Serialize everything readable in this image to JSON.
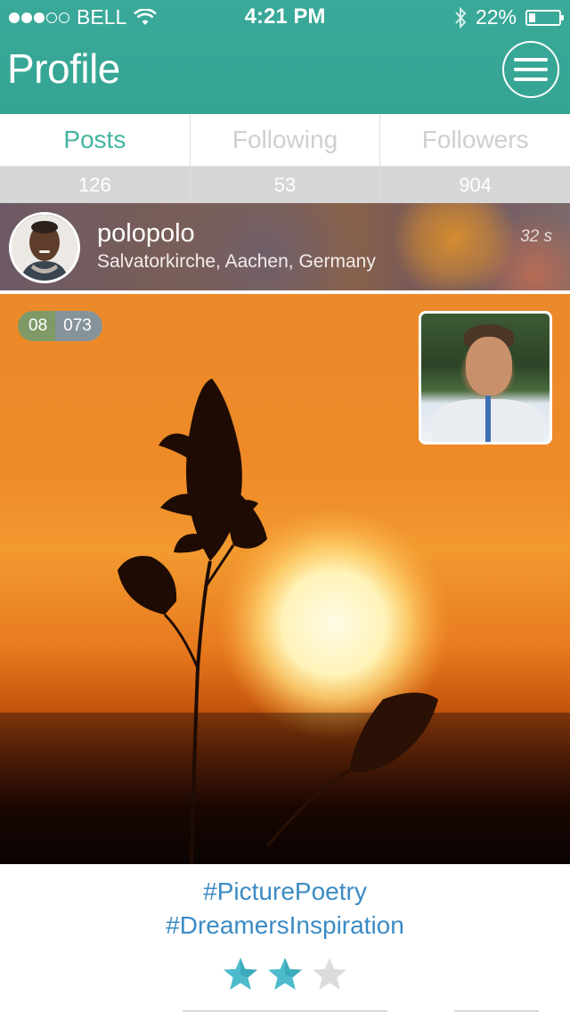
{
  "status_bar": {
    "carrier": "BELL",
    "signal_bars_filled": 3,
    "signal_bars_total": 5,
    "time": "4:21 PM",
    "battery": "22%",
    "battery_level": 0.22,
    "icons": [
      "wifi-icon",
      "bluetooth-icon",
      "battery-icon"
    ]
  },
  "header": {
    "title": "Profile",
    "menu_icon": "hamburger-menu-icon"
  },
  "tabs": [
    {
      "label": "Posts",
      "count": "126",
      "active": true
    },
    {
      "label": "Following",
      "count": "53",
      "active": false
    },
    {
      "label": "Followers",
      "count": "904",
      "active": false
    }
  ],
  "post": {
    "username": "polopolo",
    "location": "Salvatorkirche, Aachen, Germany",
    "time_ago": "32 s",
    "counter_left": "08",
    "counter_right": "073",
    "hashtags": [
      "#PicturePoetry",
      "#DreamersInspiration"
    ],
    "rating": 2,
    "rating_max": 3
  },
  "colors": {
    "header_bg": "#38a796",
    "active_tab": "#45b4a2",
    "inactive_tab": "#cfcfcf",
    "count_bg": "#d6d6d6",
    "hashtag": "#3b8bc4",
    "star_filled": "#4dbbcb",
    "star_empty": "#dcdcdc"
  }
}
